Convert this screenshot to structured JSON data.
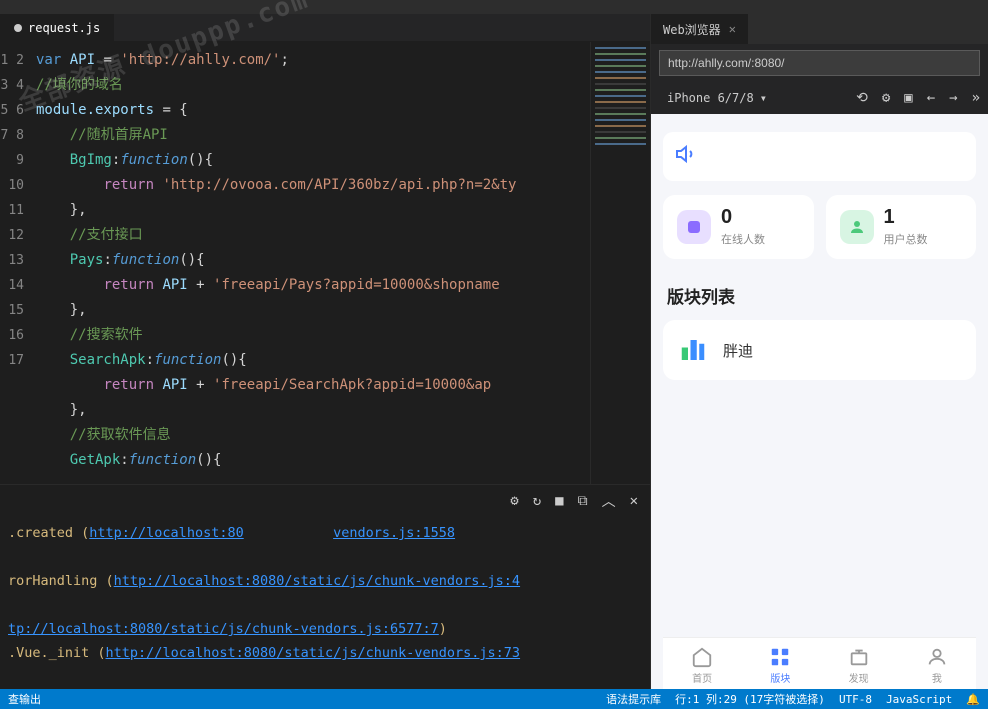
{
  "tabs": {
    "editor_tab": "request.js"
  },
  "browser": {
    "tab_title": "Web浏览器",
    "url": "http://ahlly.com/:8080/",
    "device": "iPhone 6/7/8"
  },
  "code": {
    "lines": [
      1,
      2,
      3,
      4,
      5,
      6,
      7,
      8,
      9,
      10,
      11,
      12,
      13,
      14,
      15,
      16,
      17
    ],
    "l1_var": "var",
    "l1_id": "API",
    "l1_eq": " = ",
    "l1_str": "'http://ahlly.com/'",
    "l1_end": ";",
    "l2": "//填你的域名",
    "l3_id": "module.exports",
    "l3_eq": " = {",
    "l4": "//随机首屏API",
    "l5_name": "BgImg",
    "l5_fn": "function",
    "l5_paren": "(){",
    "l6_ret": "return ",
    "l6_str": "'http://ovooa.com/API/360bz/api.php?n=2&ty",
    "l7": "},",
    "l8": "//支付接口",
    "l9_name": "Pays",
    "l9_fn": "function",
    "l9_paren": "(){",
    "l10_ret": "return ",
    "l10_id": "API",
    "l10_plus": " + ",
    "l10_str": "'freeapi/Pays?appid=10000&shopname",
    "l11": "},",
    "l12": "//搜索软件",
    "l13_name": "SearchApk",
    "l13_fn": "function",
    "l13_paren": "(){",
    "l14_ret": "return ",
    "l14_id": "API",
    "l14_plus": " + ",
    "l14_str": "'freeapi/SearchApk?appid=10000&ap",
    "l15": "},",
    "l16": "//获取软件信息",
    "l17_name": "GetApk",
    "l17_fn": "function",
    "l17_paren": "(){"
  },
  "terminal": {
    "t1_pre": ".created (",
    "t1_link": "http://localhost:80",
    "t1_mid": "           ",
    "t1_link2": "vendors.js:1558",
    "t2_pre": "rorHandling (",
    "t2_link": "http://localhost:8080/static/js/chunk-vendors.js:4",
    "t3_link": "tp://localhost:8080/static/js/chunk-vendors.js:6577:7",
    "t3_end": ")",
    "t4_pre": ".Vue._init (",
    "t4_link": "http://localhost:8080/static/js/chunk-vendors.js:73"
  },
  "preview": {
    "cards": [
      {
        "num": "0",
        "lbl": "在线人数"
      },
      {
        "num": "1",
        "lbl": "用户总数"
      }
    ],
    "section_title": "版块列表",
    "board_name": "胖迪",
    "nav": [
      {
        "label": "首页"
      },
      {
        "label": "版块"
      },
      {
        "label": "发现"
      },
      {
        "label": "我"
      }
    ]
  },
  "status": {
    "s1": "查输出",
    "s2": "语法提示库",
    "s3": "行:1 列:29 (17字符被选择)",
    "s4": "UTF-8",
    "s5": "JavaScript"
  },
  "watermark": "全部资源\ndouppp.com"
}
